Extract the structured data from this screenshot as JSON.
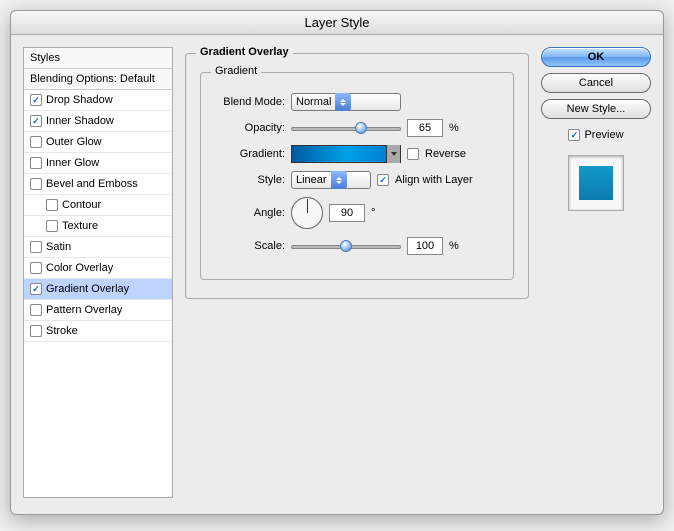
{
  "title": "Layer Style",
  "left": {
    "styles_header": "Styles",
    "blending_header": "Blending Options: Default",
    "items": [
      {
        "label": "Drop Shadow",
        "checked": true,
        "indent": false
      },
      {
        "label": "Inner Shadow",
        "checked": true,
        "indent": false
      },
      {
        "label": "Outer Glow",
        "checked": false,
        "indent": false
      },
      {
        "label": "Inner Glow",
        "checked": false,
        "indent": false
      },
      {
        "label": "Bevel and Emboss",
        "checked": false,
        "indent": false
      },
      {
        "label": "Contour",
        "checked": false,
        "indent": true
      },
      {
        "label": "Texture",
        "checked": false,
        "indent": true
      },
      {
        "label": "Satin",
        "checked": false,
        "indent": false
      },
      {
        "label": "Color Overlay",
        "checked": false,
        "indent": false
      },
      {
        "label": "Gradient Overlay",
        "checked": true,
        "indent": false,
        "selected": true
      },
      {
        "label": "Pattern Overlay",
        "checked": false,
        "indent": false
      },
      {
        "label": "Stroke",
        "checked": false,
        "indent": false
      }
    ]
  },
  "center": {
    "group_title": "Gradient Overlay",
    "inner_title": "Gradient",
    "blend_mode_label": "Blend Mode:",
    "blend_mode_value": "Normal",
    "opacity_label": "Opacity:",
    "opacity_value": "65",
    "opacity_pct": 65,
    "pct_sign": "%",
    "gradient_label": "Gradient:",
    "reverse_label": "Reverse",
    "reverse_checked": false,
    "style_label": "Style:",
    "style_value": "Linear",
    "align_label": "Align with Layer",
    "align_checked": true,
    "angle_label": "Angle:",
    "angle_value": "90",
    "degree": "°",
    "scale_label": "Scale:",
    "scale_value": "100",
    "scale_pct": 50
  },
  "right": {
    "ok": "OK",
    "cancel": "Cancel",
    "new_style": "New Style...",
    "preview_label": "Preview",
    "preview_checked": true
  }
}
